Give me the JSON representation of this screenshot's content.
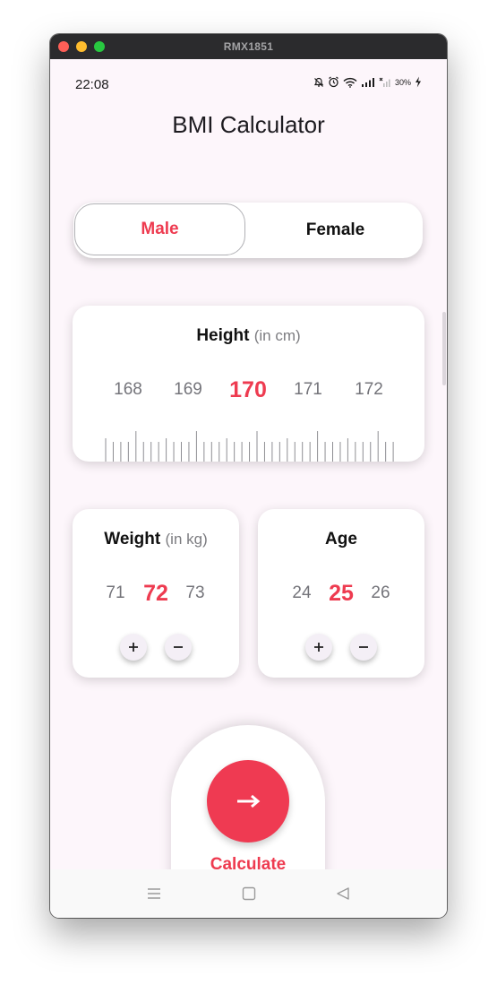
{
  "window": {
    "title": "RMX1851"
  },
  "status_bar": {
    "time": "22:08",
    "icons": [
      "mute-bell-icon",
      "alarm-icon",
      "wifi-icon",
      "signal-icon",
      "no-signal-icon",
      "battery-charging-icon"
    ],
    "battery": "30%"
  },
  "app": {
    "title": "BMI Calculator"
  },
  "gender": {
    "male": "Male",
    "female": "Female",
    "selected": "Male"
  },
  "height": {
    "label": "Height",
    "unit": "(in cm)",
    "values": [
      "168",
      "169",
      "170",
      "171",
      "172"
    ],
    "selected": "170"
  },
  "weight": {
    "label": "Weight",
    "unit": "(in kg)",
    "prev": "71",
    "value": "72",
    "next": "73",
    "plus": "+",
    "minus": "−"
  },
  "age": {
    "label": "Age",
    "prev": "24",
    "value": "25",
    "next": "26",
    "plus": "+",
    "minus": "−"
  },
  "calculate": {
    "label": "Calculate",
    "icon": "arrow-right-icon"
  },
  "nav": {
    "icons": [
      "menu-icon",
      "home-square-icon",
      "back-triangle-icon"
    ]
  },
  "colors": {
    "accent": "#ee3b50",
    "background": "#fdf6fb",
    "card": "#ffffff"
  }
}
